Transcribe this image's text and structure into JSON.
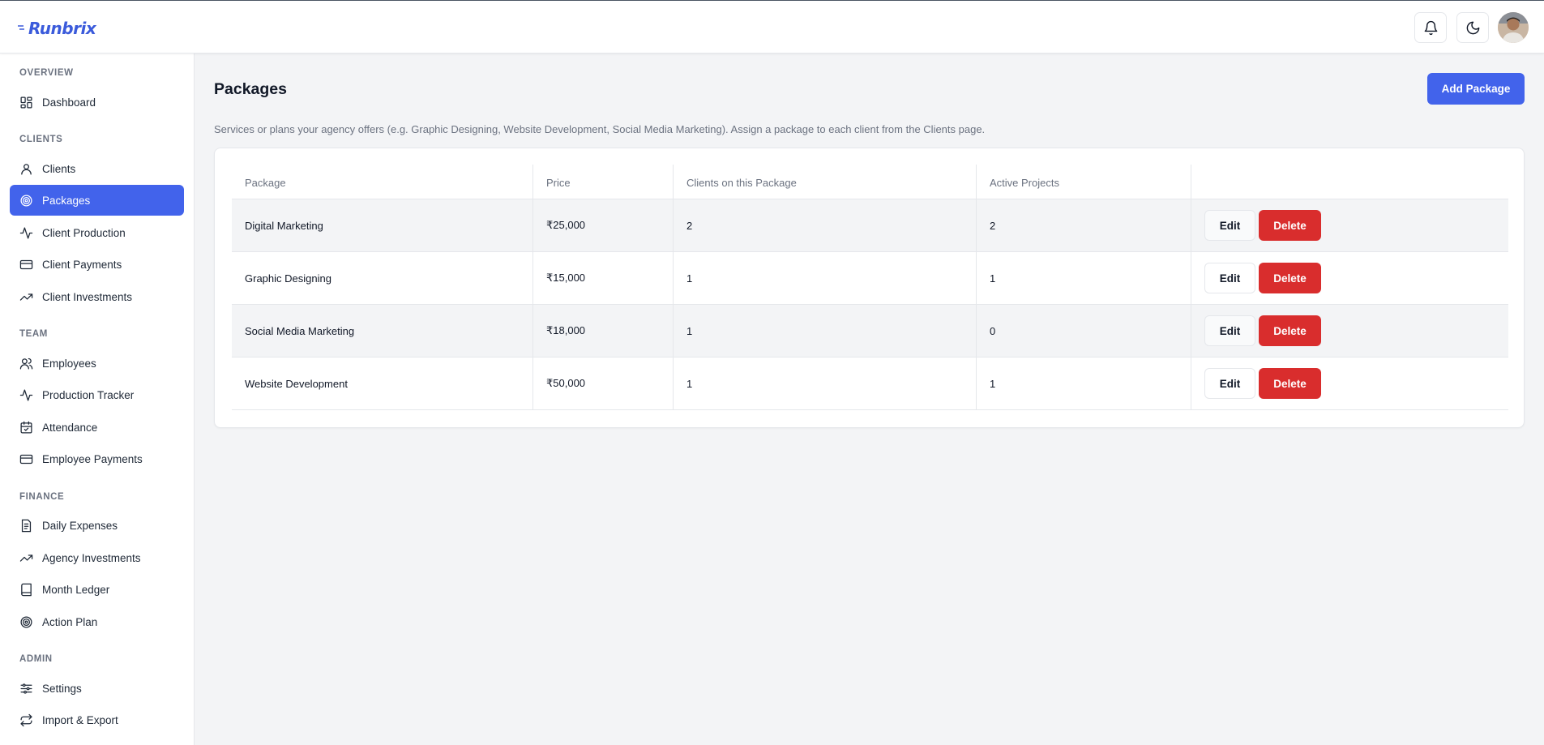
{
  "app": {
    "logo_text": "Runbrix"
  },
  "header": {
    "notifications_icon": "bell-icon",
    "theme_icon": "moon-icon",
    "avatar_icon": "user-avatar"
  },
  "sidebar": {
    "sections": [
      {
        "label": "OVERVIEW",
        "items": [
          {
            "label": "Dashboard",
            "icon": "grid-icon"
          }
        ]
      },
      {
        "label": "CLIENTS",
        "items": [
          {
            "label": "Clients",
            "icon": "user-icon"
          },
          {
            "label": "Packages",
            "icon": "target-icon",
            "active": true
          },
          {
            "label": "Client Production",
            "icon": "activity-icon"
          },
          {
            "label": "Client Payments",
            "icon": "credit-card-icon"
          },
          {
            "label": "Client Investments",
            "icon": "trending-up-icon"
          }
        ]
      },
      {
        "label": "TEAM",
        "items": [
          {
            "label": "Employees",
            "icon": "users-icon"
          },
          {
            "label": "Production Tracker",
            "icon": "activity-icon"
          },
          {
            "label": "Attendance",
            "icon": "calendar-check-icon"
          },
          {
            "label": "Employee Payments",
            "icon": "credit-card-icon"
          }
        ]
      },
      {
        "label": "FINANCE",
        "items": [
          {
            "label": "Daily Expenses",
            "icon": "receipt-icon"
          },
          {
            "label": "Agency Investments",
            "icon": "trending-up-icon"
          },
          {
            "label": "Month Ledger",
            "icon": "book-icon"
          },
          {
            "label": "Action Plan",
            "icon": "target-icon"
          }
        ]
      },
      {
        "label": "ADMIN",
        "items": [
          {
            "label": "Settings",
            "icon": "sliders-icon"
          },
          {
            "label": "Import & Export",
            "icon": "repeat-icon"
          }
        ]
      }
    ]
  },
  "main": {
    "title": "Packages",
    "add_button": "Add Package",
    "description": "Services or plans your agency offers (e.g. Graphic Designing, Website Development, Social Media Marketing). Assign a package to each client from the Clients page.",
    "table": {
      "headers": [
        "Package",
        "Price",
        "Clients on this Package",
        "Active Projects",
        ""
      ],
      "rows": [
        {
          "package": "Digital Marketing",
          "price": "₹25,000",
          "clients": "2",
          "active": "2"
        },
        {
          "package": "Graphic Designing",
          "price": "₹15,000",
          "clients": "1",
          "active": "1"
        },
        {
          "package": "Social Media Marketing",
          "price": "₹18,000",
          "clients": "1",
          "active": "0"
        },
        {
          "package": "Website Development",
          "price": "₹50,000",
          "clients": "1",
          "active": "1"
        }
      ],
      "edit_label": "Edit",
      "delete_label": "Delete"
    }
  },
  "colors": {
    "accent": "#4263eb",
    "danger": "#d92d2d",
    "background": "#f3f4f6"
  }
}
